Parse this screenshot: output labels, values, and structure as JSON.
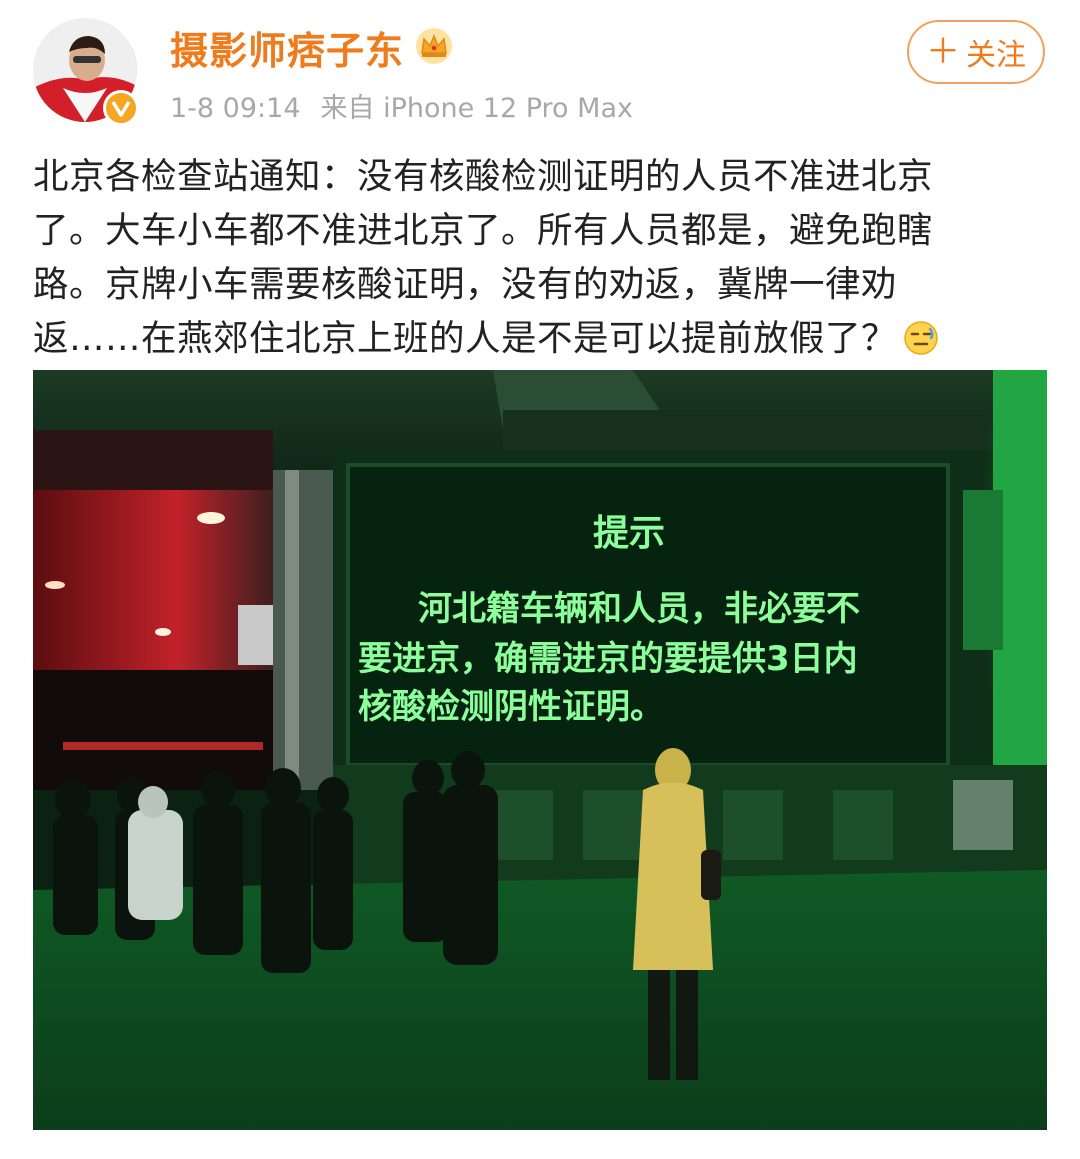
{
  "post": {
    "username": "摄影师痞子东",
    "time": "1-8 09:14",
    "source": "来自 iPhone 12 Pro Max",
    "follow_label": "关注",
    "follow_icon": "plus-icon",
    "badge_icon": "crown-icon",
    "verified_icon": "verified-v-icon",
    "text_lines": [
      "北京各检查站通知：没有核酸检测证明的人员不准进北京",
      "了。大车小车都不准进北京了。所有人员都是，避免跑瞎",
      "路。京牌小车需要核酸证明，没有的劝返，冀牌一律劝",
      "返……在燕郊住北京上班的人是不是可以提前放假了？"
    ],
    "emoji": "speechless-emoji-icon"
  },
  "photo": {
    "sign_title": "提示",
    "sign_lines": [
      "河北籍车辆和人员，非必要不",
      "要进京，确需进京的要提供3日内",
      "核酸检测阴性证明。"
    ]
  },
  "colors": {
    "username": "#f07b1c",
    "meta": "#a8a8a8",
    "text": "#222222",
    "sign_text": "#8cff9c",
    "accent_green": "#1f9a3a"
  }
}
